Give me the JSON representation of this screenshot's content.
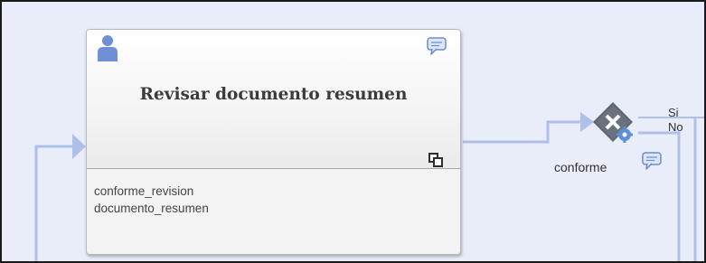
{
  "task": {
    "title": "Revisar documento resumen",
    "data_items": [
      "conforme_revision",
      "documento_resumen"
    ],
    "icons": [
      "user-icon",
      "comment-icon",
      "subprocess-icon"
    ]
  },
  "gateway": {
    "label": "conforme",
    "icons": [
      "gateway-x-icon",
      "gear-icon",
      "comment-icon"
    ]
  },
  "branches": {
    "yes_label": "Si",
    "no_label": "No"
  },
  "colors": {
    "canvas_bg": "#e9edf9",
    "connector": "#aec0e8",
    "user_icon": "#6f8fd6",
    "comment_icon": "#6a8dcc",
    "gateway": "#5f6670"
  }
}
